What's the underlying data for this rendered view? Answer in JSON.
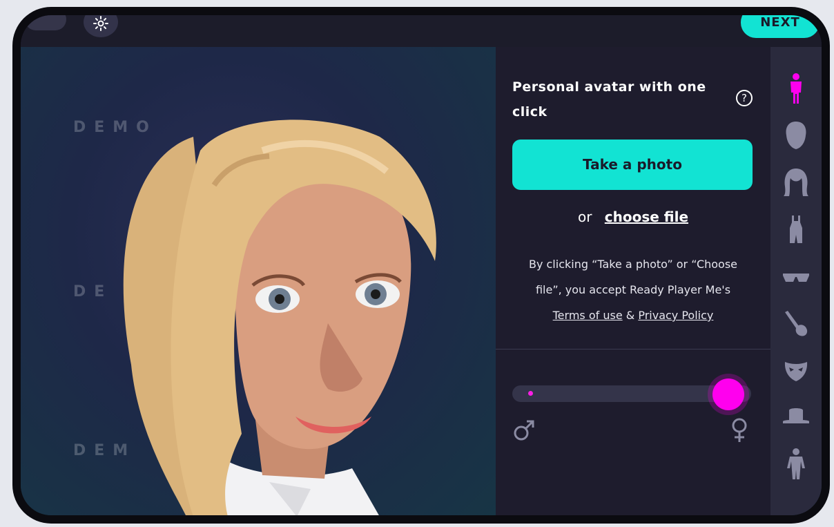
{
  "topbar": {
    "next_label": "NEXT"
  },
  "viewport": {
    "watermarks": [
      "DEMO",
      "DE",
      "DEM"
    ]
  },
  "panel": {
    "title": "Personal avatar with one click",
    "help_icon": "question-circle-icon",
    "take_photo_label": "Take a photo",
    "or_text": "or",
    "choose_file_label": "choose file",
    "consent_line1": "By clicking “Take a photo” or “Choose",
    "consent_line2": "file”, you accept Ready Player Me's",
    "terms_label": "Terms of use",
    "amp": "&",
    "privacy_label": "Privacy Policy"
  },
  "gender_slider": {
    "value": 0.93,
    "left_icon": "male-symbol-icon",
    "right_icon": "female-symbol-icon"
  },
  "rail": {
    "items": [
      {
        "icon": "full-body-icon",
        "active": true
      },
      {
        "icon": "head-icon",
        "active": false
      },
      {
        "icon": "hair-icon",
        "active": false
      },
      {
        "icon": "outfit-icon",
        "active": false
      },
      {
        "icon": "glasses-icon",
        "active": false
      },
      {
        "icon": "makeup-brush-icon",
        "active": false
      },
      {
        "icon": "mask-icon",
        "active": false
      },
      {
        "icon": "hat-icon",
        "active": false
      },
      {
        "icon": "body-shape-icon",
        "active": false
      }
    ]
  },
  "colors": {
    "accent": "#12e3d3",
    "slider": "#ff00ee",
    "rail_active": "#ff00ee",
    "rail_inactive": "#8b8ba3"
  }
}
